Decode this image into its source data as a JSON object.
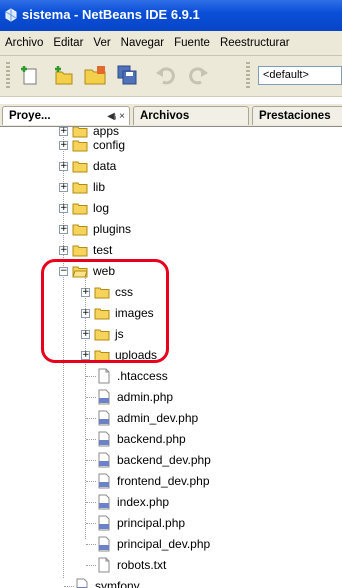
{
  "window": {
    "title": "sistema - NetBeans IDE 6.9.1"
  },
  "menu": [
    "Archivo",
    "Editar",
    "Ver",
    "Navegar",
    "Fuente",
    "Reestructurar"
  ],
  "toolbar": {
    "config_value": "<default>"
  },
  "tabs": [
    {
      "label": "Proye...",
      "controls": "◀ᵢ ×"
    },
    {
      "label": "Archivos"
    },
    {
      "label": "Prestaciones"
    }
  ],
  "tree": {
    "top_folders": [
      "apps",
      "config",
      "data",
      "lib",
      "log",
      "plugins",
      "test",
      "web"
    ],
    "web_children": [
      "css",
      "images",
      "js",
      "uploads"
    ],
    "web_files": [
      ".htaccess",
      "admin.php",
      "admin_dev.php",
      "backend.php",
      "backend_dev.php",
      "frontend_dev.php",
      "index.php",
      "principal.php",
      "principal_dev.php",
      "robots.txt"
    ],
    "root_file": "symfony"
  },
  "colors": {
    "highlight": "#e8001c",
    "title_bar": "#0a4fd8"
  }
}
